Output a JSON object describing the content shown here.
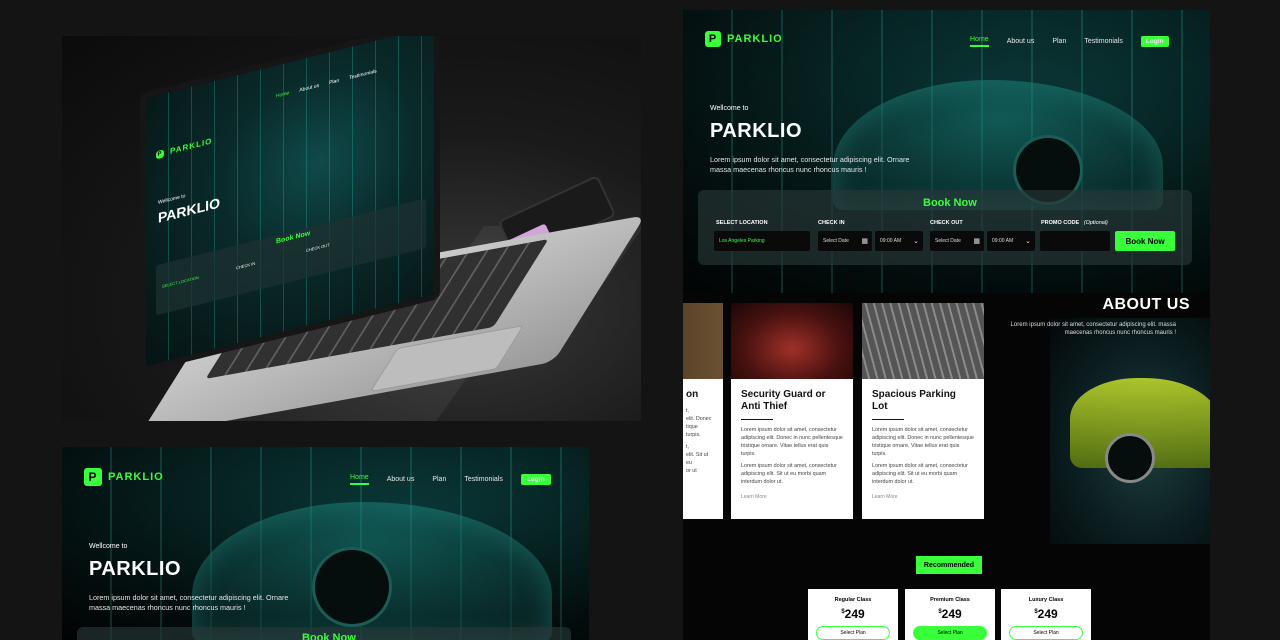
{
  "colors": {
    "accent": "#39ff3a",
    "background": "#141414",
    "hero": "#0a3534"
  },
  "brand": {
    "name": "PARKLIO",
    "logo_icon": "P"
  },
  "nav": {
    "home": "Home",
    "about": "About us",
    "plan": "Plan",
    "testimonials": "Testimonials",
    "login": "Login"
  },
  "hero": {
    "welcome": "Wellcome to",
    "title": "PARKLIO",
    "desc_line1": "Lorem ipsum dolor sit amet, consectetur adipiscing elit. Ornare",
    "desc_line2": "massa maecenas rhoncus nunc rhoncus mauris !"
  },
  "booking": {
    "heading": "Book Now",
    "location_label": "SELECT LOCATION",
    "location_value": "Los Angeles Parking",
    "checkin_label": "CHECK IN",
    "checkout_label": "CHECK OUT",
    "date_placeholder": "Select Date",
    "time_value": "09:00 AM",
    "promo_label": "PROMO CODE",
    "promo_optional": "(Optional)",
    "button": "Book Now"
  },
  "features": [
    {
      "title": "on",
      "title_line2": "",
      "p1": "t,\nelit. Donec\ntique\nturpis.",
      "p2": "t,\nelit. Sit ut eu\nor ut",
      "more": ""
    },
    {
      "title": "Security Guard or",
      "title_line2": "Anti Thief",
      "p1": "Lorem ipsum dolor sit amet, consectetur adipiscing elit. Donec in nunc pellentesque tristique ornare. Vitae tellus erat quis turpis.",
      "p2": "Lorem ipsum dolor sit amet, consectetur adipiscing elit. Sit ut eu morbi quam interdum dolor ut.",
      "more": "Learn More"
    },
    {
      "title": "Spacious Parking",
      "title_line2": "Lot",
      "p1": "Lorem ipsum dolor sit amet, consectetur adipiscing elit. Donec in nunc pellentesque tristique ornare. Vitae tellus erat quis turpis.",
      "p2": "Lorem ipsum dolor sit amet, consectetur adipiscing elit. Sit ut eu morbi quam interdum dolor ut.",
      "more": "Learn More"
    }
  ],
  "about": {
    "title": "ABOUT US",
    "text": "Lorem ipsum dolor sit amet, consectetur adipiscing elit. massa maecenas rhoncus nunc rhoncus mauris !"
  },
  "pricing": {
    "badge": "Recommended",
    "plans": [
      {
        "name": "Regular Class",
        "currency": "$",
        "price": "249",
        "cta": "Select Plan"
      },
      {
        "name": "Premium Class",
        "currency": "$",
        "price": "249",
        "cta": "Select Plan"
      },
      {
        "name": "Luxury Class",
        "currency": "$",
        "price": "249",
        "cta": "Select Plan"
      }
    ]
  }
}
